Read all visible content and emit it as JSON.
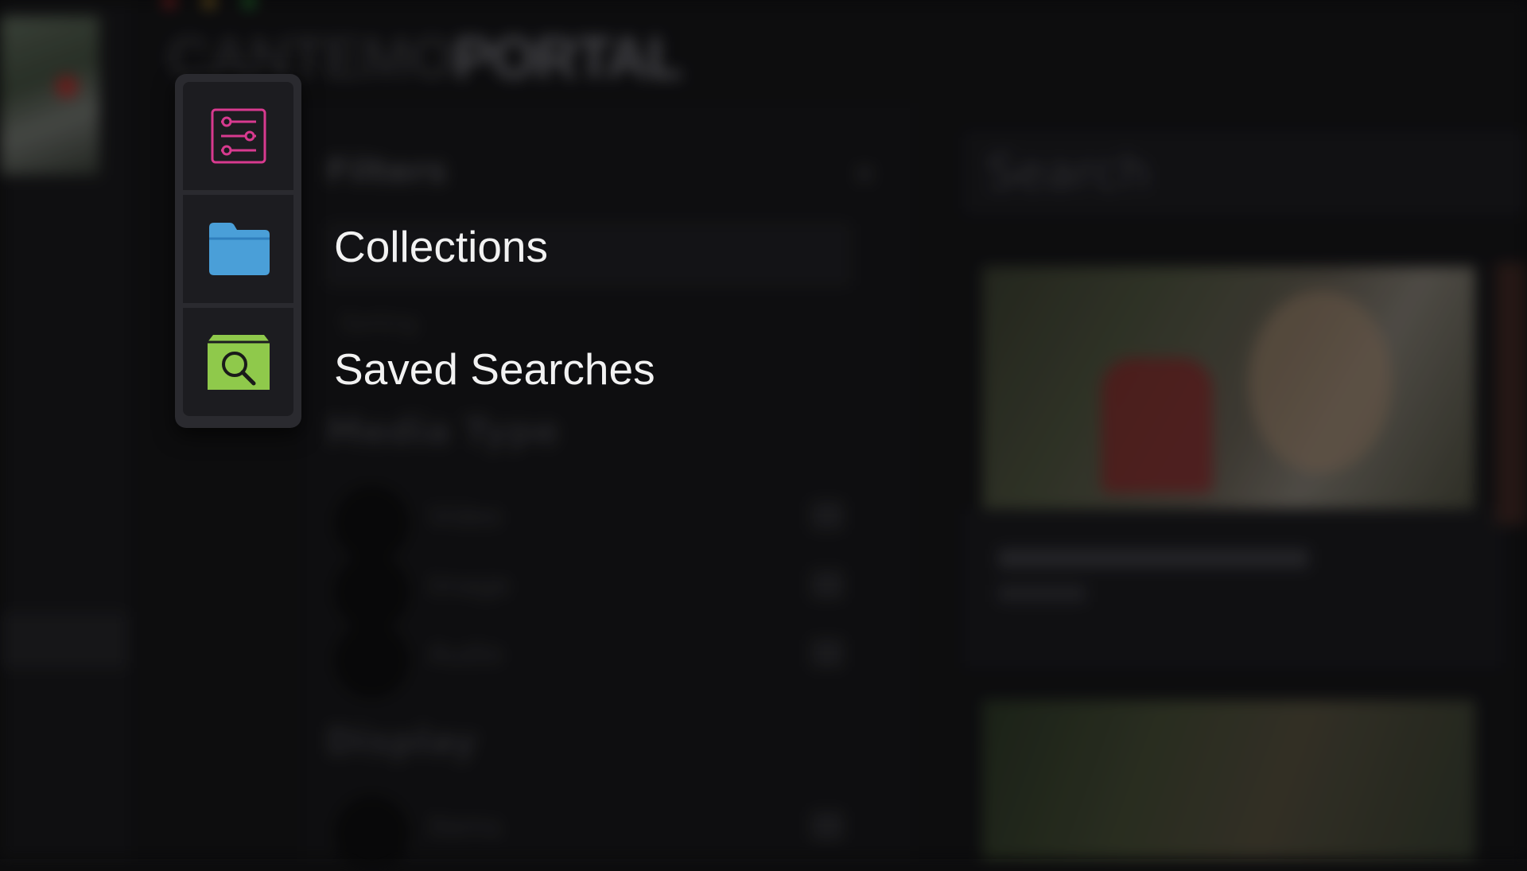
{
  "background_app": {
    "logo_light": "CANTEMO",
    "logo_strong": "PORTAL",
    "filters_title": "Filters",
    "close_glyph": "×",
    "sort_label": "Sorting",
    "section_media_type": "Media Type",
    "media_types": [
      "Video",
      "Image",
      "Audio"
    ],
    "section_display": "Display",
    "display_options": [
      "Items"
    ],
    "search_placeholder": "Search"
  },
  "menu": {
    "items": [
      {
        "id": "filters",
        "label": "",
        "icon": "filters-icon",
        "color": "#d83a8f"
      },
      {
        "id": "collections",
        "label": "Collections",
        "icon": "folder-icon",
        "color": "#4a9fd8"
      },
      {
        "id": "saved_searches",
        "label": "Saved Searches",
        "icon": "saved-search-icon",
        "color": "#8fc94b"
      }
    ]
  }
}
